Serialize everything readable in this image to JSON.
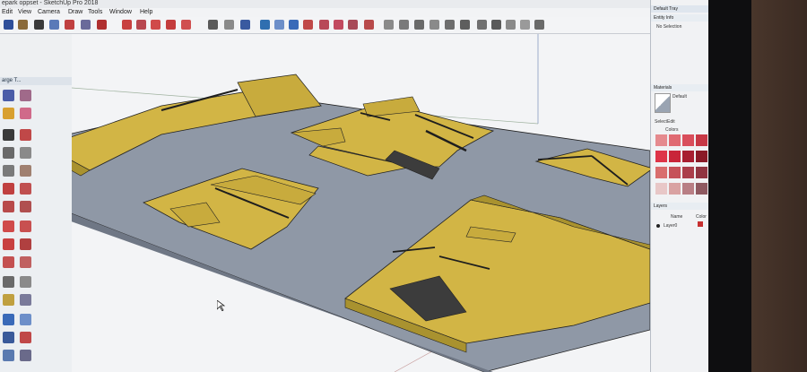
{
  "window": {
    "title": "epark oppset - SketchUp Pro 2018"
  },
  "menu": {
    "items": [
      "Edit",
      "View",
      "Camera",
      "Draw",
      "Tools",
      "Window",
      "Help"
    ]
  },
  "left_toolbar": {
    "title": "arge T..."
  },
  "tray": {
    "title": "Default Tray",
    "entity_info": "Entity Info",
    "selection": "No Selection",
    "materials": "Materials",
    "material_name": "Default",
    "tab_select": "Select",
    "tab_edit": "Edit",
    "colors_label": "Colors",
    "layers": "Layers",
    "layer_name_header": "Name",
    "layer_color_header": "Color",
    "layer_name": "Layer0",
    "swatches": [
      [
        "#e58a8e",
        "#e06a72",
        "#d94e5b",
        "#c73845"
      ],
      [
        "#de3448",
        "#c92539",
        "#a81e30",
        "#8a1926"
      ],
      [
        "#d96e6e",
        "#c65259",
        "#ab3e4a",
        "#913541"
      ],
      [
        "#e8c7c7",
        "#d9a2a2",
        "#b87e84",
        "#8e5960"
      ]
    ]
  },
  "colors": {
    "floor": "#8f98a6",
    "ramp": "#d2b545",
    "ramp_dark": "#a9922f",
    "edge": "#222222",
    "rail": "#1e1e1e"
  }
}
